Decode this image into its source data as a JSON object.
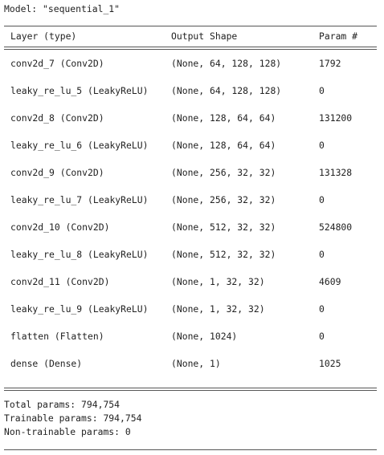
{
  "model_line": "Model: \"sequential_1\"",
  "headers": {
    "layer": "Layer (type)",
    "output_shape": "Output Shape",
    "params": "Param #"
  },
  "rows": [
    {
      "layer": "conv2d_7 (Conv2D)",
      "shape": "(None, 64, 128, 128)",
      "params": "1792"
    },
    {
      "layer": "leaky_re_lu_5 (LeakyReLU)",
      "shape": "(None, 64, 128, 128)",
      "params": "0"
    },
    {
      "layer": "conv2d_8 (Conv2D)",
      "shape": "(None, 128, 64, 64)",
      "params": "131200"
    },
    {
      "layer": "leaky_re_lu_6 (LeakyReLU)",
      "shape": "(None, 128, 64, 64)",
      "params": "0"
    },
    {
      "layer": "conv2d_9 (Conv2D)",
      "shape": "(None, 256, 32, 32)",
      "params": "131328"
    },
    {
      "layer": "leaky_re_lu_7 (LeakyReLU)",
      "shape": "(None, 256, 32, 32)",
      "params": "0"
    },
    {
      "layer": "conv2d_10 (Conv2D)",
      "shape": "(None, 512, 32, 32)",
      "params": "524800"
    },
    {
      "layer": "leaky_re_lu_8 (LeakyReLU)",
      "shape": "(None, 512, 32, 32)",
      "params": "0"
    },
    {
      "layer": "conv2d_11 (Conv2D)",
      "shape": "(None, 1, 32, 32)",
      "params": "4609"
    },
    {
      "layer": "leaky_re_lu_9 (LeakyReLU)",
      "shape": "(None, 1, 32, 32)",
      "params": "0"
    },
    {
      "layer": "flatten (Flatten)",
      "shape": "(None, 1024)",
      "params": "0"
    },
    {
      "layer": "dense (Dense)",
      "shape": "(None, 1)",
      "params": "1025"
    }
  ],
  "summary": {
    "total": "Total params: 794,754",
    "trainable": "Trainable params: 794,754",
    "non_trainable": "Non-trainable params: 0"
  }
}
